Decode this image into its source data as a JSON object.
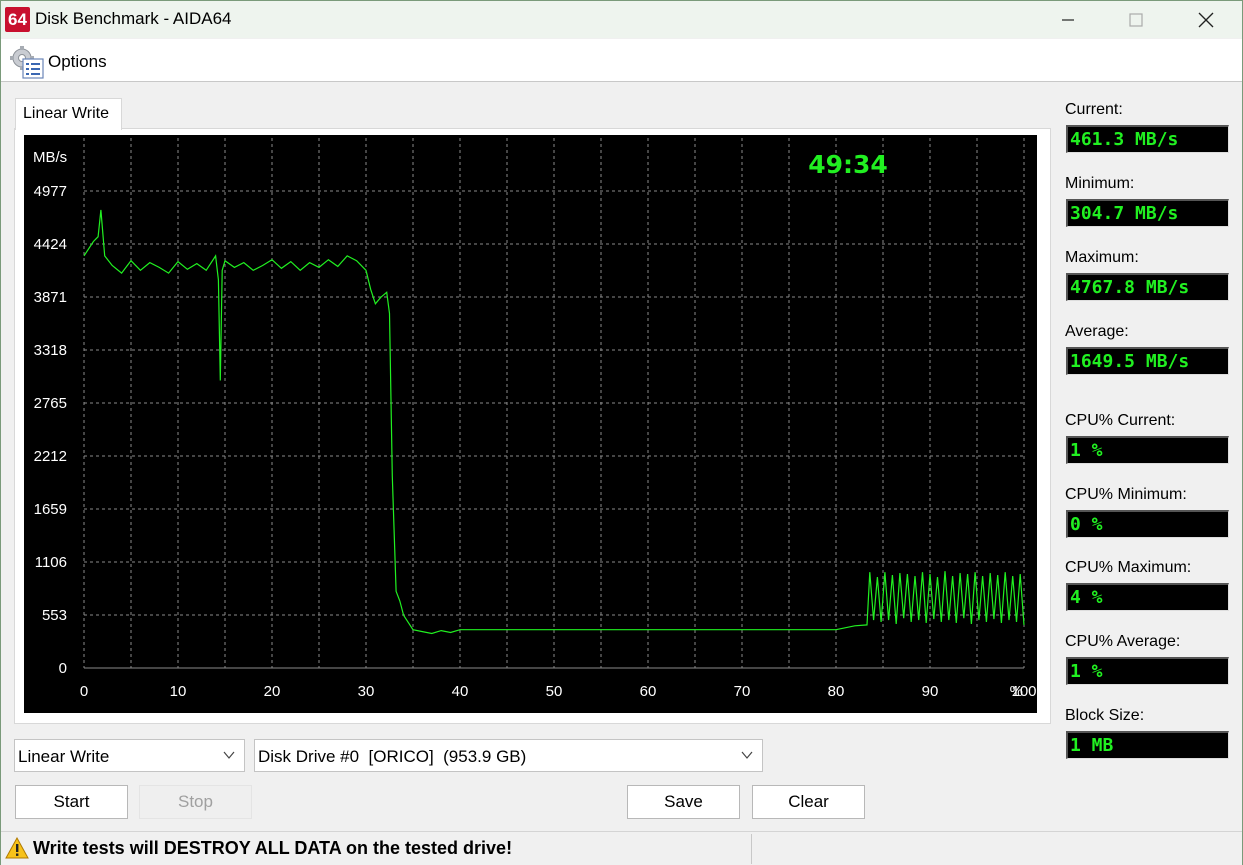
{
  "window": {
    "title": "Disk Benchmark - AIDA64",
    "app_icon_text": "64"
  },
  "menu": {
    "options_label": "Options"
  },
  "tab": {
    "label": "Linear Write"
  },
  "stats": [
    {
      "label": "Current:",
      "value": "461.3 MB/s"
    },
    {
      "label": "Minimum:",
      "value": "304.7 MB/s"
    },
    {
      "label": "Maximum:",
      "value": "4767.8 MB/s"
    },
    {
      "label": "Average:",
      "value": "1649.5 MB/s"
    },
    {
      "label": "CPU% Current:",
      "value": "1 %"
    },
    {
      "label": "CPU% Minimum:",
      "value": "0 %"
    },
    {
      "label": "CPU% Maximum:",
      "value": "4 %"
    },
    {
      "label": "CPU% Average:",
      "value": "1 %"
    },
    {
      "label": "Block Size:",
      "value": "1 MB"
    }
  ],
  "controls": {
    "test_select": "Linear Write",
    "drive_select": "Disk Drive #0  [ORICO]  (953.9 GB)",
    "start_label": "Start",
    "stop_label": "Stop",
    "save_label": "Save",
    "clear_label": "Clear"
  },
  "status": {
    "warning": "Write tests will DESTROY ALL DATA on the tested drive!"
  },
  "colors": {
    "line": "#21f021",
    "timer": "#21f021",
    "grid": "#8a8a8a",
    "axis_text": "#ffffff"
  },
  "chart_data": {
    "type": "line",
    "elapsed": "49:34",
    "ylabel": "MB/s",
    "xlabel": "%",
    "ylim": [
      0,
      5530
    ],
    "xlim": [
      0,
      100
    ],
    "yticks": [
      0,
      553,
      1106,
      1659,
      2212,
      2765,
      3318,
      3871,
      4424,
      4977
    ],
    "xticks": [
      0,
      10,
      20,
      30,
      40,
      50,
      60,
      70,
      80,
      90,
      100
    ],
    "grid": true,
    "series": [
      {
        "x": [
          0,
          1.0,
          1.5,
          1.8,
          2.2,
          3.0,
          4,
          5,
          6,
          7,
          8,
          9,
          10,
          11,
          12,
          13,
          14,
          14.3,
          14.5,
          14.7,
          15.0,
          16,
          17,
          18,
          19,
          20,
          21,
          22,
          23,
          24,
          25,
          26,
          27,
          28,
          29,
          30,
          30.5,
          31.0,
          31.6,
          32.2,
          32.5,
          32.8,
          33.2,
          33.6,
          34,
          35,
          36,
          37,
          38,
          39,
          40,
          45,
          50,
          55,
          60,
          65,
          70,
          75,
          80,
          82,
          83.3,
          83.6,
          84.0,
          84.4,
          84.8,
          85.2,
          85.6,
          86.0,
          86.4,
          86.8,
          87.2,
          87.6,
          88.0,
          88.4,
          88.8,
          89.2,
          89.6,
          90.0,
          90.4,
          90.8,
          91.2,
          91.6,
          92.0,
          92.4,
          92.8,
          93.2,
          93.6,
          94.0,
          94.4,
          94.8,
          95.2,
          95.6,
          96.0,
          96.4,
          96.8,
          97.2,
          97.6,
          98.0,
          98.4,
          98.8,
          99.2,
          99.6,
          100
        ],
        "y": [
          4300,
          4450,
          4500,
          4780,
          4300,
          4200,
          4120,
          4250,
          4150,
          4230,
          4180,
          4120,
          4240,
          4160,
          4220,
          4150,
          4300,
          4050,
          3000,
          4150,
          4250,
          4180,
          4230,
          4150,
          4200,
          4260,
          4170,
          4240,
          4150,
          4230,
          4180,
          4260,
          4190,
          4300,
          4250,
          4150,
          3950,
          3800,
          3870,
          3920,
          3700,
          2000,
          800,
          700,
          550,
          400,
          380,
          360,
          390,
          370,
          400,
          400,
          400,
          400,
          400,
          400,
          400,
          400,
          400,
          440,
          450,
          1000,
          500,
          950,
          480,
          1000,
          500,
          970,
          460,
          990,
          520,
          980,
          480,
          960,
          500,
          1000,
          470,
          980,
          510,
          950,
          480,
          1010,
          500,
          960,
          470,
          990,
          520,
          980,
          460,
          1000,
          500,
          960,
          480,
          990,
          510,
          970,
          470,
          1000,
          500,
          960,
          480,
          980,
          450
        ]
      }
    ]
  }
}
